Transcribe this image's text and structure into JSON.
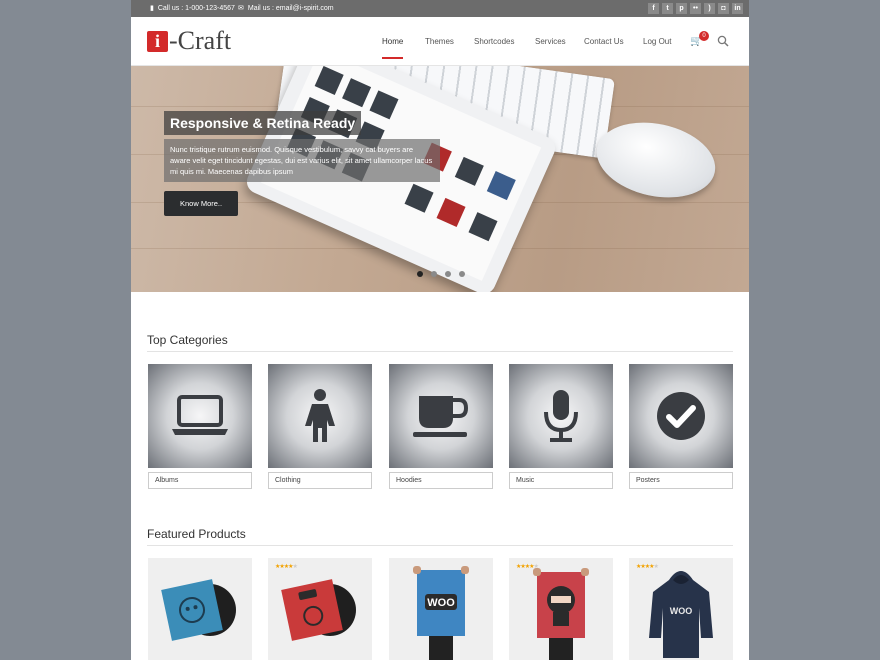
{
  "topbar": {
    "call": "Call us : 1-000-123-4567",
    "mail": "Mail us : email@i-spirit.com",
    "social_icons": [
      "facebook-icon",
      "twitter-icon",
      "pinterest-icon",
      "flickr-icon",
      "rss-icon",
      "instagram-icon",
      "linkedin-icon"
    ]
  },
  "logo": {
    "mark": "i",
    "text": "-Craft"
  },
  "nav": {
    "items": [
      "Home",
      "Themes",
      "Shortcodes",
      "Services",
      "Contact Us",
      "Log Out"
    ],
    "active": "Home"
  },
  "cart": {
    "count": "0"
  },
  "hero": {
    "title": "Responsive & Retina Ready",
    "text": "Nunc tristique rutrum euismod. Quisque vestibulum, savvy cat buyers are aware velit eget tincidunt egestas, dui est varius elit, sit amet ullamcorper lacus mi quis mi. Maecenas dapibus ipsum",
    "button": "Know More..",
    "slides": 4,
    "active_slide": 1
  },
  "categories": {
    "title": "Top Categories",
    "items": [
      {
        "label": "Albums",
        "icon": "laptop-icon"
      },
      {
        "label": "Clothing",
        "icon": "person-icon"
      },
      {
        "label": "Hoodies",
        "icon": "cup-icon"
      },
      {
        "label": "Music",
        "icon": "microphone-icon"
      },
      {
        "label": "Posters",
        "icon": "checkmark-icon"
      }
    ]
  },
  "featured": {
    "title": "Featured Products",
    "items": [
      {
        "image": "vinyl-album-blue",
        "rating": null
      },
      {
        "image": "vinyl-album-red",
        "rating": 4
      },
      {
        "image": "woo-poster",
        "rating": null
      },
      {
        "image": "ninja-poster",
        "rating": 4
      },
      {
        "image": "woo-hoodie",
        "rating": 4
      }
    ]
  },
  "colors": {
    "accent": "#d32a2a",
    "topbar": "#6c6c6c",
    "backdrop": "#838a93"
  }
}
